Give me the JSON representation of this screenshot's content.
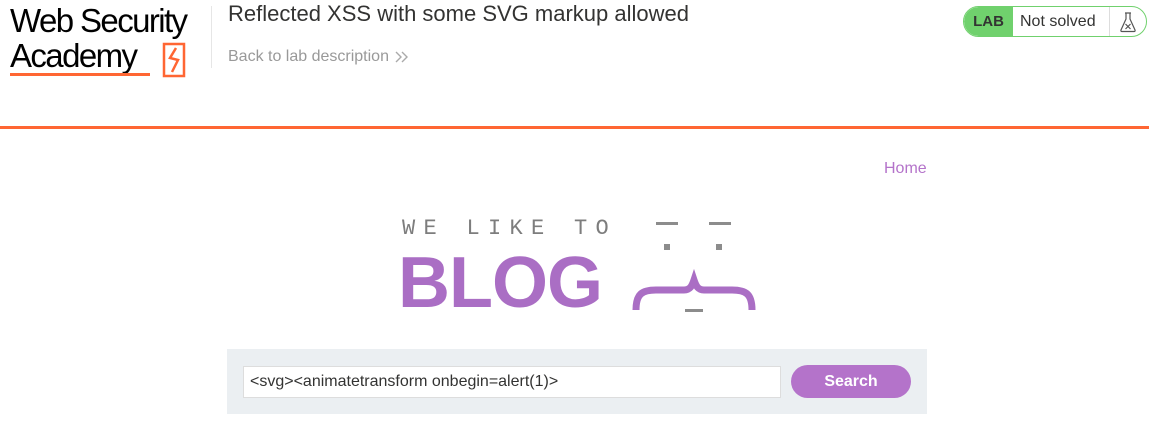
{
  "header": {
    "logo_line1": "Web Security",
    "logo_line2": "Academy",
    "lab_title": "Reflected XSS with some SVG markup allowed",
    "back_link": "Back to lab description",
    "status": {
      "badge": "LAB",
      "text": "Not solved",
      "icon": "flask-icon"
    }
  },
  "blog": {
    "nav": {
      "home": "Home"
    },
    "banner": {
      "tagline": "WE LIKE TO",
      "title": "BLOG"
    },
    "search": {
      "value": "<svg><animatetransform onbegin=alert(1)>",
      "button_label": "Search"
    }
  },
  "colors": {
    "accent_orange": "#ff6633",
    "status_green": "#70d16d",
    "blog_purple": "#b473ca",
    "panel_bg": "#ebeff2"
  }
}
